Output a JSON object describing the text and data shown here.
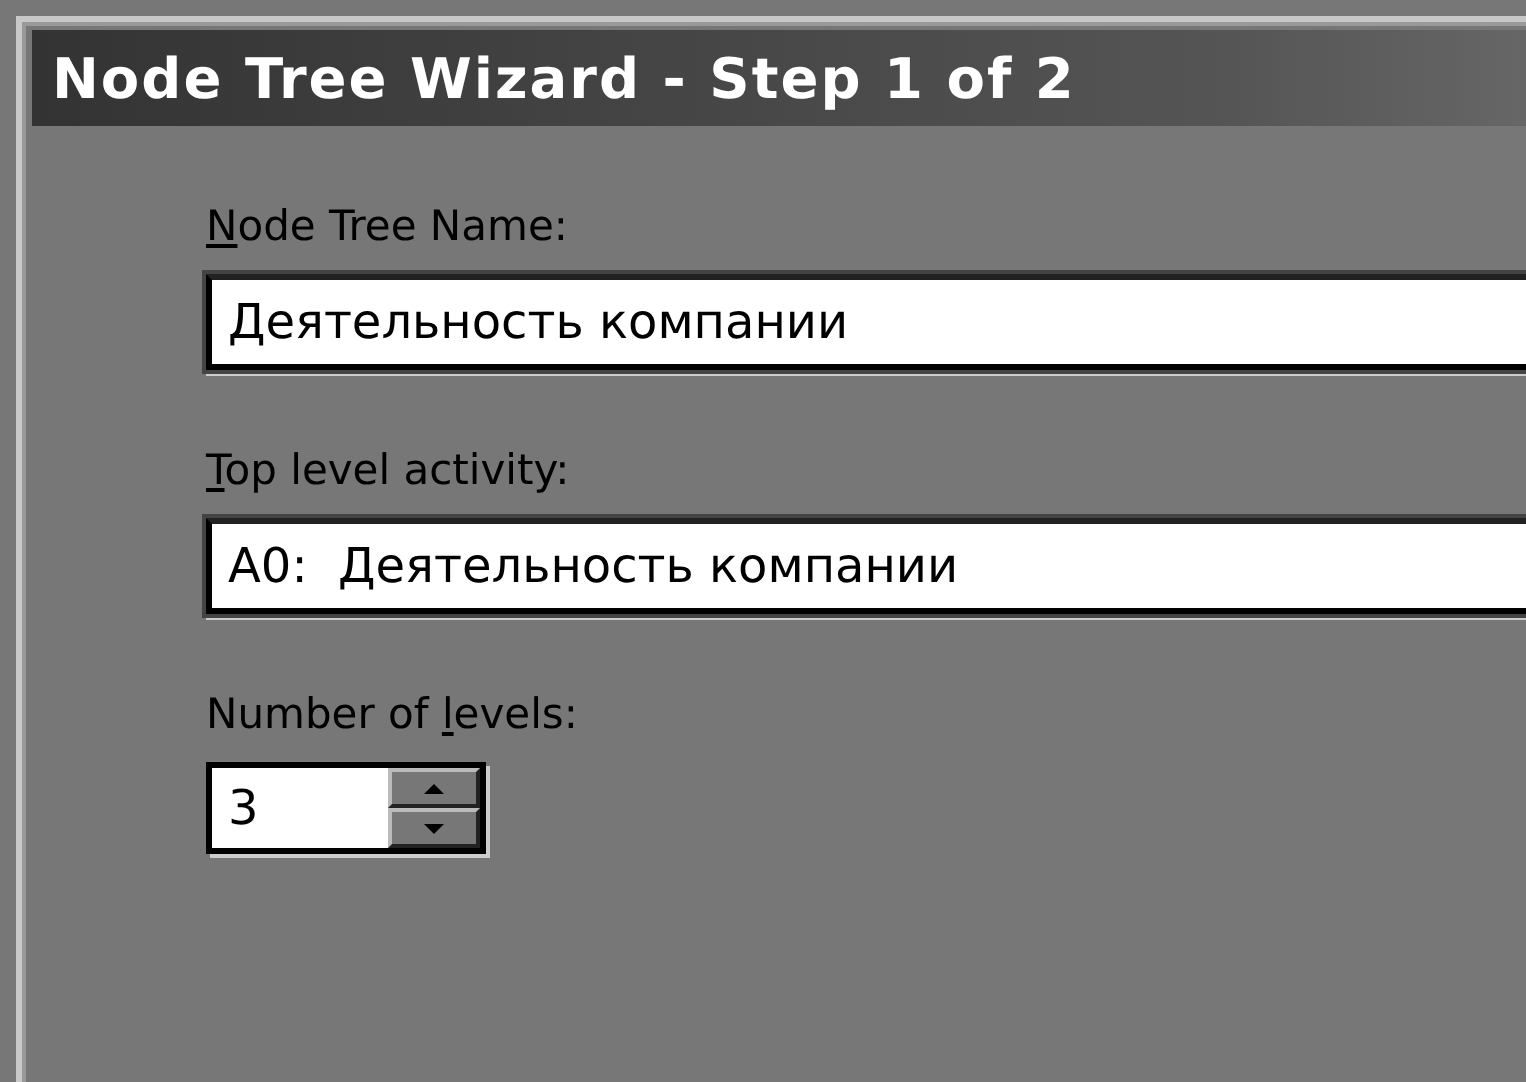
{
  "window": {
    "title": "Node Tree Wizard - Step 1 of 2"
  },
  "fields": [
    {
      "kind": "text",
      "label": {
        "key": "N",
        "after": "ode Tree Name:"
      },
      "value": "Деятельность компании"
    },
    {
      "kind": "text",
      "label": {
        "key": "T",
        "after": "op level activity:"
      },
      "value": "A0:  Деятельность компании"
    },
    {
      "kind": "spinner",
      "label": {
        "before": "Number of ",
        "key": "l",
        "after": "evels:"
      },
      "value": "3"
    }
  ]
}
